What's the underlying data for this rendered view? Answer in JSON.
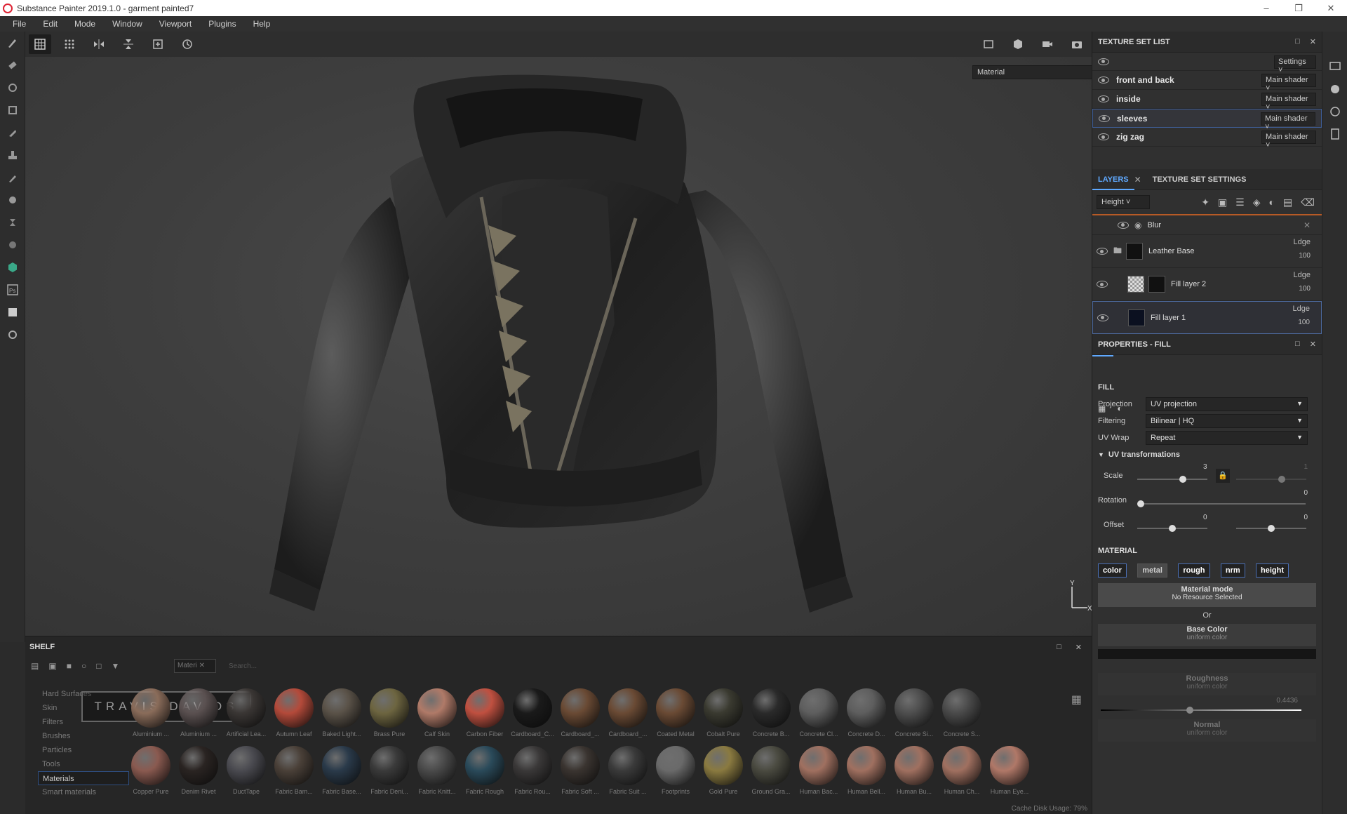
{
  "window": {
    "title": "Substance Painter 2019.1.0 - garment painted7"
  },
  "menu": [
    "File",
    "Edit",
    "Mode",
    "Window",
    "Viewport",
    "Plugins",
    "Help"
  ],
  "viewport": {
    "channel_select": "Material"
  },
  "texture_set_list": {
    "title": "TEXTURE SET LIST",
    "settings_label": "Settings",
    "sets": [
      {
        "name": "front and back",
        "shader": "Main shader"
      },
      {
        "name": "inside",
        "shader": "Main shader"
      },
      {
        "name": "sleeves",
        "shader": "Main shader"
      },
      {
        "name": "zig zag",
        "shader": "Main shader"
      }
    ],
    "selected_index": 2
  },
  "layers_panel": {
    "tabs": [
      "LAYERS",
      "TEXTURE SET SETTINGS"
    ],
    "channel": "Height",
    "effect": {
      "name": "Blur"
    },
    "layers": [
      {
        "name": "Leather Base",
        "blend": "Ldge",
        "opacity": "100"
      },
      {
        "name": "Fill layer 2",
        "blend": "Ldge",
        "opacity": "100"
      },
      {
        "name": "Fill layer 1",
        "blend": "Ldge",
        "opacity": "100"
      }
    ]
  },
  "properties": {
    "title": "PROPERTIES - FILL",
    "fill_label": "FILL",
    "projection_label": "Projection",
    "projection_value": "UV projection",
    "filtering_label": "Filtering",
    "filtering_value": "Bilinear | HQ",
    "uvwrap_label": "UV Wrap",
    "uvwrap_value": "Repeat",
    "uvt_label": "UV transformations",
    "scale_label": "Scale",
    "scale_value": "3",
    "scale_value2": "1",
    "rotation_label": "Rotation",
    "rotation_value": "0",
    "offset_label": "Offset",
    "offset_x": "0",
    "offset_y": "0",
    "material_label": "MATERIAL",
    "channels": [
      "color",
      "metal",
      "rough",
      "nrm",
      "height"
    ],
    "material_mode_label": "Material mode",
    "material_mode_value": "No Resource Selected",
    "or_label": "Or",
    "base_color_label": "Base Color",
    "base_color_sub": "uniform color",
    "roughness_label": "Roughness",
    "roughness_sub": "uniform color",
    "roughness_value": "0.4436",
    "normal_label": "Normal",
    "normal_sub": "uniform color"
  },
  "shelf": {
    "title": "SHELF",
    "search_tab": "Materi",
    "search_placeholder": "Search...",
    "categories": [
      "Hard Surfaces",
      "Skin",
      "Filters",
      "Brushes",
      "Particles",
      "Tools",
      "Materials",
      "Smart materials"
    ],
    "active_category": "Materials",
    "watermark": "TRAVIS DAVIDS",
    "row1": [
      "Aluminium ...",
      "Aluminium ...",
      "Artificial Lea...",
      "Autumn Leaf",
      "Baked Light...",
      "Brass Pure",
      "Calf Skin",
      "Carbon Fiber",
      "Cardboard_C...",
      "Cardboard_...",
      "Cardboard_...",
      "Coated Metal",
      "Cobalt Pure",
      "Concrete B...",
      "Concrete Cl...",
      "Concrete D...",
      "Concrete Si...",
      "Concrete S..."
    ],
    "row2": [
      "Copper Pure",
      "Denim Rivet",
      "DuctTape",
      "Fabric Bam...",
      "Fabric Base...",
      "Fabric Deni...",
      "Fabric Knitt...",
      "Fabric Rough",
      "Fabric Rou...",
      "Fabric Soft ...",
      "Fabric Suit ...",
      "Footprints",
      "Gold Pure",
      "Ground Gra...",
      "Human Bac...",
      "Human Bell...",
      "Human Bu...",
      "Human Ch...",
      "Human Eye..."
    ],
    "cache_label": "Cache Disk Usage:",
    "cache_value": "79%"
  }
}
